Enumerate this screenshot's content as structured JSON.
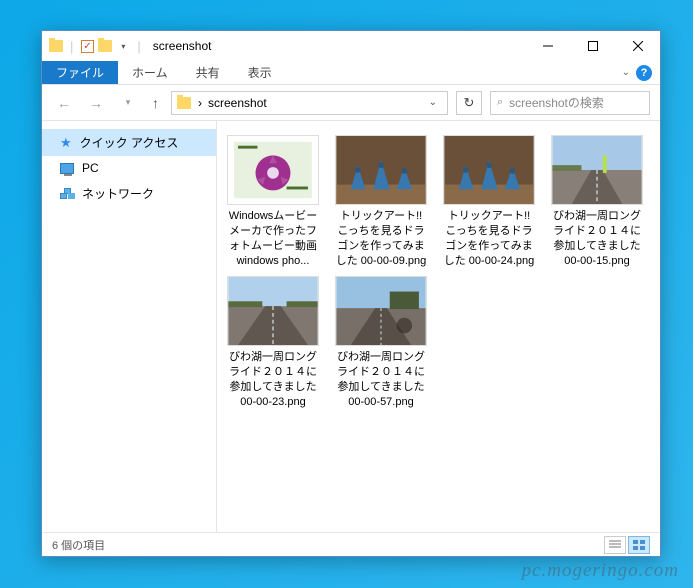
{
  "window": {
    "title": "screenshot"
  },
  "ribbon": {
    "file": "ファイル",
    "home": "ホーム",
    "share": "共有",
    "view": "表示"
  },
  "address": {
    "path": "screenshot",
    "breadcrumb_sep": "›"
  },
  "search": {
    "placeholder": "screenshotの検索"
  },
  "sidebar": {
    "quick_access": "クイック アクセス",
    "pc": "PC",
    "network": "ネットワーク"
  },
  "files": [
    {
      "name": "Windowsムービーメーカで作ったフォトムービー動画 windows pho...",
      "thumb": "flower"
    },
    {
      "name": "トリックアート!! こっちを見るドラゴンを作ってみました 00-00-09.png",
      "thumb": "dragon"
    },
    {
      "name": "トリックアート!! こっちを見るドラゴンを作ってみました 00-00-24.png",
      "thumb": "dragon"
    },
    {
      "name": "びわ湖一周ロングライド２０１４に参加してきました 00-00-15.png",
      "thumb": "road1"
    },
    {
      "name": "びわ湖一周ロングライド２０１４に参加してきました 00-00-23.png",
      "thumb": "road2"
    },
    {
      "name": "びわ湖一周ロングライド２０１４に参加してきました 00-00-57.png",
      "thumb": "road3"
    }
  ],
  "status": {
    "count": "6 個の項目"
  },
  "watermark": "pc.mogeringo.com"
}
